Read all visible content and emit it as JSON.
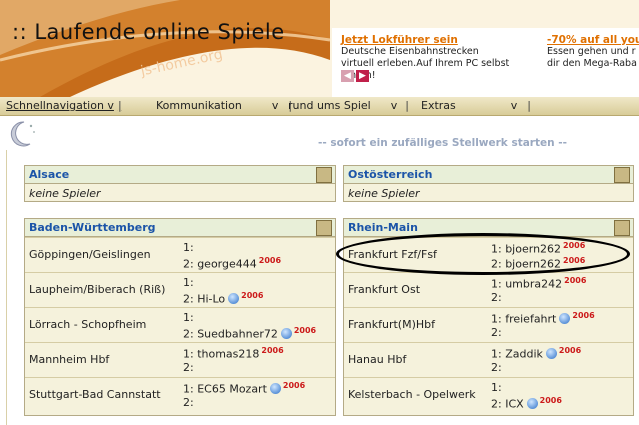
{
  "header": {
    "title": ":: Laufende online Spiele",
    "watermark": "js-home.org"
  },
  "ads": [
    {
      "title": "Jetzt Lokführer sein",
      "text": "Deutsche Eisenbahnstrecken virtuell erleben.Auf Ihrem PC selbst fahren!"
    },
    {
      "title": "-70% auf all you",
      "text": "Essen gehen und r dir den Mega-Raba"
    }
  ],
  "nav": {
    "items": [
      "Schnellnavigation v",
      "Kommunikation",
      "rund ums Spiel",
      "Extras"
    ],
    "chevron": "v",
    "separator": "|"
  },
  "random_link": "-- sofort ein zufälliges Stellwerk starten --",
  "panels": {
    "alsace": {
      "title": "Alsace",
      "empty": "keine Spieler"
    },
    "ostoesterreich": {
      "title": "Ostösterreich",
      "empty": "keine Spieler"
    },
    "baden": {
      "title": "Baden-Württemberg",
      "rows": [
        {
          "station": "Göppingen/Geislingen",
          "s1": "1:",
          "s2": "2: george444",
          "year": "2006",
          "globe": false
        },
        {
          "station": "Laupheim/Biberach (Riß)",
          "s1": "1:",
          "s2": "2: Hi-Lo",
          "year": "2006",
          "globe": true
        },
        {
          "station": "Lörrach - Schopfheim",
          "s1": "1:",
          "s2": "2: Suedbahner72",
          "year": "2006",
          "globe": true
        },
        {
          "station": "Mannheim Hbf",
          "s1": "1: thomas218",
          "s2": "2:",
          "year": "2006",
          "globe": false
        },
        {
          "station": "Stuttgart-Bad Cannstatt",
          "s1": "1: EC65 Mozart",
          "s2": "2:",
          "year": "2006",
          "globe": true
        }
      ]
    },
    "rhein": {
      "title": "Rhein-Main",
      "rows": [
        {
          "station": "Frankfurt Fzf/Fsf",
          "s1": "1: bjoern262",
          "s2": "2: bjoern262",
          "year": "2006"
        },
        {
          "station": "Frankfurt Ost",
          "s1": "1: umbra242",
          "s2": "2:",
          "year": "2006"
        },
        {
          "station": "Frankfurt(M)Hbf",
          "s1": "1: freiefahrt",
          "s2": "2:",
          "year": "2006"
        },
        {
          "station": "Hanau Hbf",
          "s1": "1: Zaddik",
          "s2": "2:",
          "year": "2006"
        },
        {
          "station": "Kelsterbach - Opelwerk",
          "s1": "1:",
          "s2": "2: ICX",
          "year": "2006"
        }
      ]
    }
  },
  "colors": {
    "panel_title": "#1b54a8",
    "year_badge": "#cc1a1a",
    "ad_title": "#e07000"
  }
}
